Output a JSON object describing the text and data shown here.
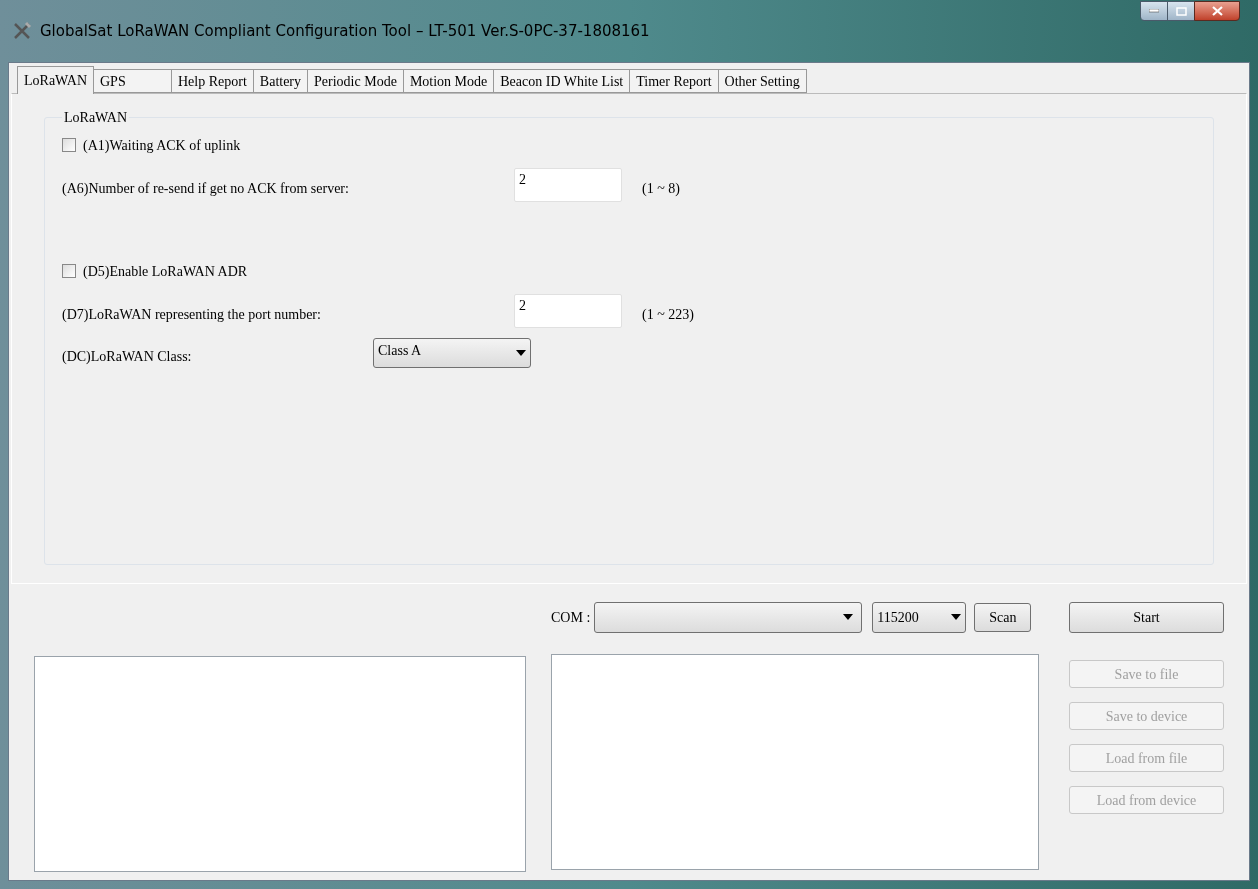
{
  "window": {
    "title": "GlobalSat LoRaWAN Compliant Configuration Tool – LT-501 Ver.S-0PC-37-1808161"
  },
  "tabs": [
    {
      "label": "LoRaWAN",
      "selected": true
    },
    {
      "label": "GPS",
      "selected": false
    },
    {
      "label": "Help Report",
      "selected": false
    },
    {
      "label": "Battery",
      "selected": false
    },
    {
      "label": "Periodic Mode",
      "selected": false
    },
    {
      "label": "Motion Mode",
      "selected": false
    },
    {
      "label": "Beacon ID White List",
      "selected": false
    },
    {
      "label": "Timer Report",
      "selected": false
    },
    {
      "label": "Other Setting",
      "selected": false
    }
  ],
  "group": {
    "title": "LoRaWAN",
    "sections": [
      [
        {
          "kind": "checkbox",
          "label": "(A1)Waiting ACK of uplink",
          "checked": false
        },
        {
          "kind": "number",
          "label": "(A6)Number of re-send if get no ACK from server:",
          "value": "2",
          "range": "(1 ~ 8)"
        }
      ],
      [
        {
          "kind": "checkbox",
          "label": "(D5)Enable LoRaWAN ADR",
          "checked": false
        },
        {
          "kind": "number",
          "label": "(D7)LoRaWAN representing the port number:",
          "value": "2",
          "range": "(1 ~ 223)"
        },
        {
          "kind": "dropdown",
          "label": "(DC)LoRaWAN Class:",
          "value": "Class A"
        }
      ]
    ]
  },
  "connection": {
    "com_label": "COM :",
    "baud": "115200",
    "scan": "Scan",
    "start": "Start"
  },
  "actions": [
    {
      "label": "Save to file",
      "disabled": true
    },
    {
      "label": "Save to device",
      "disabled": true
    },
    {
      "label": "Load from file",
      "disabled": true
    },
    {
      "label": "Load from device",
      "disabled": true
    }
  ]
}
